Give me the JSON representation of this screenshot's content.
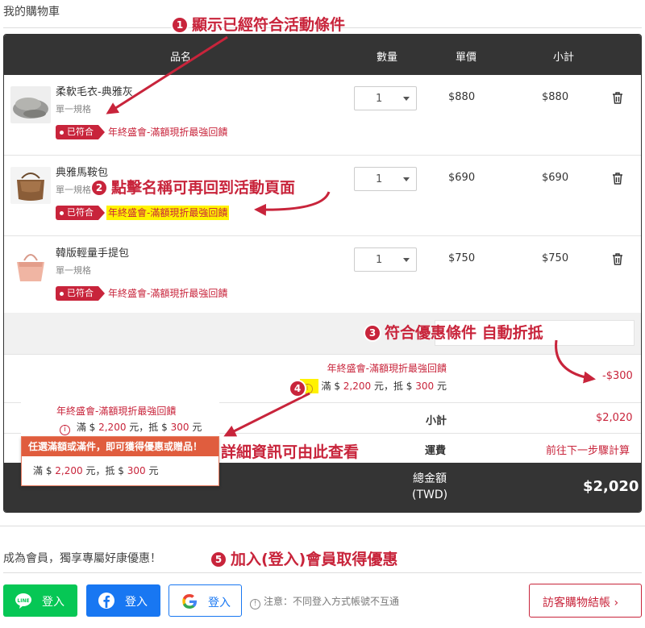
{
  "page_title": "我的購物車",
  "table_headers": {
    "name": "品名",
    "qty": "數量",
    "price": "單價",
    "subtotal": "小計"
  },
  "items": [
    {
      "name": "柔軟毛衣-典雅灰",
      "spec": "單一規格",
      "badge": "已符合",
      "promo": "年終盛會-滿額現折最強回饋",
      "qty": "1",
      "price": "$880",
      "subtotal": "$880"
    },
    {
      "name": "典雅馬鞍包",
      "spec": "單一規格",
      "badge": "已符合",
      "promo": "年終盛會-滿額現折最強回饋",
      "qty": "1",
      "price": "$690",
      "subtotal": "$690"
    },
    {
      "name": "韓版輕量手提包",
      "spec": "單一規格",
      "badge": "已符合",
      "promo": "年終盛會-滿額現折最強回饋",
      "qty": "1",
      "price": "$750",
      "subtotal": "$750"
    }
  ],
  "discount": {
    "name": "年終盛會-滿額現折最強回饋",
    "rule_prefix": "滿 $",
    "threshold": "2,200",
    "rule_mid": "元，抵 $",
    "amount": "300",
    "rule_suffix": "元",
    "value": "-$300"
  },
  "summary": {
    "subtotal_label": "小計",
    "subtotal_value": "$2,020",
    "shipping_label": "運費",
    "shipping_value": "前往下一步驟計算",
    "total_label": "總金額 (TWD)",
    "total_value": "$2,020"
  },
  "popover": {
    "name": "年終盛會-滿額現折最強回饋",
    "header": "任選滿額或滿件，即可獲得優惠或贈品！",
    "body_prefix": "滿 $",
    "threshold": "2,200",
    "body_mid": "元，抵 $",
    "amount": "300",
    "body_suffix": "元",
    "rule_prefix": "滿 $",
    "rule_mid": "元，抵 $",
    "rule_suffix": "元"
  },
  "annotations": {
    "a1_num": "1",
    "a1": "顯示已經符合活動條件",
    "a2_num": "2",
    "a2": "點擊名稱可再回到活動頁面",
    "a3_num": "3",
    "a3": "符合優惠條件 自動折抵",
    "a4_num": "4",
    "a4": "詳細資訊可由此查看",
    "a5_num": "5",
    "a5": "加入(登入)會員取得優惠"
  },
  "member": {
    "text": "成為會員，獨享專屬好康優惠！",
    "line_label": "登入",
    "fb_label": "登入",
    "google_label": "登入",
    "note": "注意：不同登入方式帳號不互通",
    "guest_label": "訪客購物結帳 ›"
  },
  "colors": {
    "brand_red": "#c8243b",
    "dark": "#343434",
    "line_green": "#06c755",
    "fb_blue": "#1877f2",
    "highlight": "#fff200"
  },
  "icons": {
    "trash": "trash-icon",
    "info": "info-icon",
    "line": "line-icon",
    "facebook": "facebook-icon",
    "google": "google-icon",
    "caret": "chevron-down-icon"
  }
}
